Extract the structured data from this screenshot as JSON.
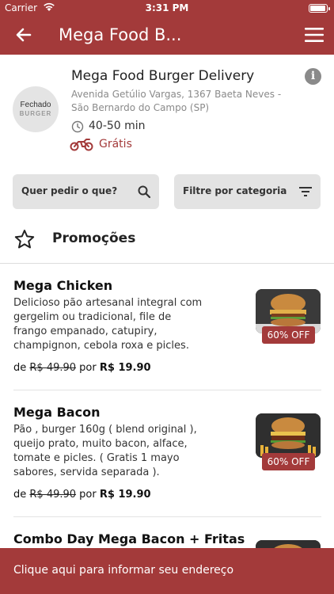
{
  "status_bar": {
    "carrier": "Carrier",
    "time": "3:31 PM",
    "wifi_icon": "wifi-icon",
    "battery_icon": "battery-icon"
  },
  "nav": {
    "title": "Mega Food B...",
    "back_icon": "arrow-left-icon",
    "menu_icon": "hamburger-menu-icon"
  },
  "restaurant": {
    "logo_text": "Fechado",
    "logo_word": "BURGER",
    "name": "Mega Food Burger Delivery",
    "address": "Avenida Getúlio Vargas, 1367 Baeta Neves - São Bernardo do Campo (SP)",
    "delivery_time": "40-50 min",
    "delivery_fee": "Grátis"
  },
  "filters": {
    "search_label": "Quer pedir o que?",
    "category_label": "Filtre por categoria"
  },
  "section": {
    "title": "Promoções"
  },
  "products": [
    {
      "name": "Mega Chicken",
      "description": "Delicioso pão artesanal integral com gergelim ou tradicional, file de frango empanado, catupiry, champignon, cebola roxa e picles.",
      "price_prefix": "de ",
      "old_price": "R$ 49.90",
      "price_mid": " por ",
      "new_price": "R$ 19.90",
      "discount": "60% OFF"
    },
    {
      "name": "Mega Bacon",
      "description": "Pão , burger 160g ( blend original ), queijo prato, muito bacon, alface, tomate e picles. ( Gratis 1 mayo sabores, servida separada ).",
      "price_prefix": "de ",
      "old_price": "R$ 49.90",
      "price_mid": " por ",
      "new_price": "R$ 19.90",
      "discount": "60% OFF"
    },
    {
      "name": "Combo Day Mega Bacon + Fritas"
    }
  ],
  "bottom_bar": {
    "text": "Clique aqui para informar seu endereço"
  },
  "colors": {
    "brand": "#a33a3a",
    "filter_bg": "#e3e3e3",
    "muted_text": "#8a8a8a"
  }
}
